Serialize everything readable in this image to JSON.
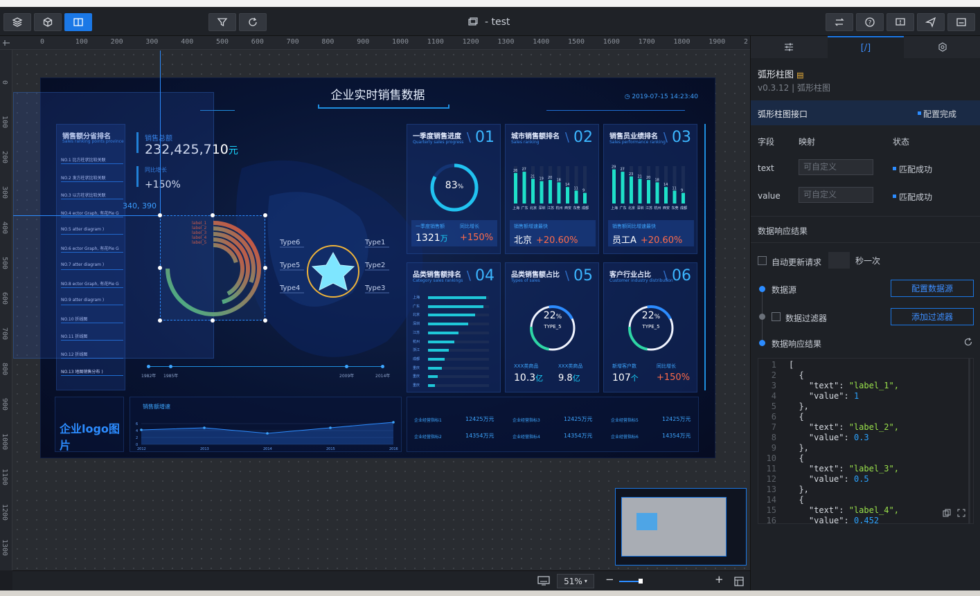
{
  "top": {
    "title": "- test",
    "buttons_left": [
      "layers-icon",
      "components-icon",
      "panel-icon"
    ],
    "buttons_mid": [
      "filter-icon",
      "refresh-icon"
    ],
    "buttons_right": [
      "publish-icon",
      "help-icon",
      "alert-icon",
      "send-icon",
      "preview-icon"
    ]
  },
  "ruler": {
    "h": [
      "0",
      "100",
      "200",
      "300",
      "400",
      "500",
      "600",
      "700",
      "800",
      "900",
      "1000",
      "1100",
      "1200",
      "1300",
      "1400",
      "1500",
      "1600",
      "1700",
      "1800",
      "1900",
      "2"
    ],
    "v": [
      "0",
      "100",
      "200",
      "300",
      "400",
      "500",
      "600",
      "700",
      "800",
      "900",
      "1000",
      "1100",
      "1200",
      "1300"
    ]
  },
  "screen": {
    "title": "企业实时销售数据",
    "time": "2019-07-15 14:23:40",
    "left_title": "销售额分省排名",
    "left_sub": "Sales ranking points province",
    "total_label": "销售总额",
    "total_value": "232,425,710",
    "total_unit": "元",
    "yoy_label": "同比增长",
    "yoy_value": "+150%",
    "coords": "340, 390",
    "list": [
      "NO.1  比方柱状比较关联",
      "NO.2  发方柱状比较关联",
      "NO.3  以方柱状比较关联",
      "NO.4  ector Graph, 有花Pie G",
      "NO.5  atter diagram )",
      "NO.6  ector Graph, 有花Pie G",
      "NO.7  atter diagram )",
      "NO.8  ector Graph, 有花Pie G",
      "NO.9  atter diagram )",
      "NO.10  折线图",
      "NO.11  折线图",
      "NO.12  折线图",
      "NO.13  地图销售分布 )"
    ],
    "radial_labels": [
      "label_1",
      "label_2",
      "label_3",
      "label_4",
      "label_5"
    ],
    "types": [
      "Type6",
      "Type1",
      "Type5",
      "Type2",
      "Type4",
      "Type3"
    ],
    "timeline": [
      "1982年",
      "1985年",
      "2009年",
      "2014年"
    ],
    "panels": [
      {
        "title": "一季度销售进度",
        "sub": "Quarterly sales progress",
        "num": "01",
        "center": "83",
        "pct": "%",
        "k1": "一季度销售额",
        "v1": "1321",
        "u1": "万",
        "k2": "同比增长",
        "v2": "+150%"
      },
      {
        "title": "城市销售额排名",
        "sub": "Sales ranking",
        "num": "02",
        "k1": "销售额增速最快",
        "v1": "北京",
        "v2": "+20.60%"
      },
      {
        "title": "销售员业绩排名",
        "sub": "Sales performance ranking",
        "num": "03",
        "k1": "销售额同比增速最快",
        "v1": "员工A",
        "v2": "+20.60%"
      },
      {
        "title": "品类销售额排名",
        "sub": "Category sales rankings",
        "num": "04"
      },
      {
        "title": "品类销售额占比",
        "sub": "Types of sales",
        "num": "05",
        "center": "22",
        "pct": "%",
        "type": "TYPE_5",
        "k1": "XXX类商品",
        "v1": "10.3",
        "u1": "亿",
        "k2": "XXX类商品",
        "v2": "9.8",
        "u2": "亿"
      },
      {
        "title": "客户行业占比",
        "sub": "Customer industry distribution",
        "num": "06",
        "center": "22",
        "pct": "%",
        "type": "TYPE_5",
        "k1": "新增客户数",
        "v1": "107",
        "u1": "个",
        "k2": "同比增长",
        "v2": "+150%"
      }
    ],
    "bars_city_vals": [
      "26",
      "27",
      "21",
      "19",
      "20",
      "18",
      "14",
      "11",
      "9"
    ],
    "bars_city_labels": [
      "上海",
      "广东",
      "北京",
      "深圳",
      "江苏",
      "杭州",
      "西安",
      "东莞",
      "成都"
    ],
    "bars_staff_vals": [
      "29",
      "27",
      "23",
      "21",
      "20",
      "18",
      "14",
      "11",
      "9"
    ],
    "bars_staff_labels": [
      "上海",
      "广东",
      "北京",
      "深圳",
      "江苏",
      "杭州",
      "西安",
      "东莞",
      "成都"
    ],
    "cat_labels": [
      "上海",
      "广东",
      "北京",
      "深圳",
      "江苏",
      "杭州",
      "浙江",
      "成都",
      "重庆",
      "重庆",
      "重庆"
    ],
    "logo": "企业logo图片",
    "trend_title": "销售额增速",
    "trend_years": [
      "2012",
      "2013",
      "2014",
      "2015",
      "2016"
    ],
    "trend_y": [
      "6",
      "4",
      "2",
      "0"
    ],
    "kpis": [
      {
        "k": "企业经营指标1",
        "v": "12425万元"
      },
      {
        "k": "企业经营指标3",
        "v": "12425万元"
      },
      {
        "k": "企业经营指标5",
        "v": "12425万元"
      },
      {
        "k": "企业经营指标2",
        "v": "14354万元"
      },
      {
        "k": "企业经营指标4",
        "v": "14354万元"
      },
      {
        "k": "企业经营指标6",
        "v": "14354万元"
      }
    ]
  },
  "sidebar": {
    "tabs": [
      "settings-icon",
      "[/]",
      "interaction-icon"
    ],
    "comp_name": "弧形柱图",
    "version": "v0.3.12 | 弧形柱图",
    "iface_title": "弧形柱图接口",
    "iface_status": "配置完成",
    "col_field": "字段",
    "col_map": "映射",
    "col_state": "状态",
    "fields": [
      {
        "name": "text",
        "placeholder": "可自定义",
        "state": "匹配成功"
      },
      {
        "name": "value",
        "placeholder": "可自定义",
        "state": "匹配成功"
      }
    ],
    "result_title": "数据响应结果",
    "auto_update": "自动更新请求",
    "per_second": "秒一次",
    "datasource": "数据源",
    "datasource_btn": "配置数据源",
    "filter": "数据过滤器",
    "filter_btn": "添加过滤器",
    "result": "数据响应结果",
    "code": [
      "[",
      "  {",
      "    \"text\": \"label_1\",",
      "    \"value\": 1",
      "  },",
      "  {",
      "    \"text\": \"label_2\",",
      "    \"value\": 0.3",
      "  },",
      "  {",
      "    \"text\": \"label_3\",",
      "    \"value\": 0.5",
      "  },",
      "  {",
      "    \"text\": \"label_4\",",
      "    \"value\": 0.452"
    ]
  },
  "bottom": {
    "zoom": "51%"
  }
}
